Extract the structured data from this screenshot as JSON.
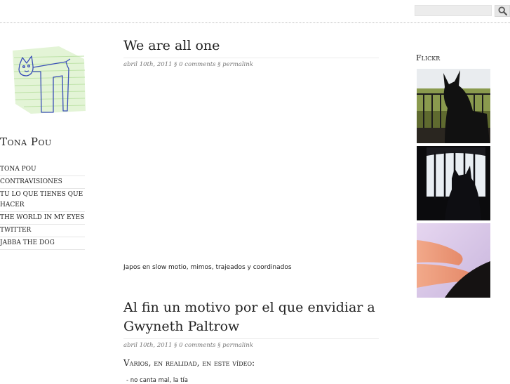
{
  "search": {
    "value": "",
    "placeholder": ""
  },
  "site": {
    "title": "Tona Pou"
  },
  "nav": {
    "items": [
      {
        "label": "Tona Pou"
      },
      {
        "label": "Contravisiones"
      },
      {
        "label": "Tu lo que tienes que hacer"
      },
      {
        "label": "The world in my eyes"
      },
      {
        "label": "Twitter"
      },
      {
        "label": "Jabba the dog"
      }
    ]
  },
  "posts": [
    {
      "title": "We are all one",
      "date": "abril 10th, 2011",
      "comments": "0 comments",
      "permalink": "permalink",
      "caption": "Japos en slow motio, mimos, trajeados y coordinados"
    },
    {
      "title_line1": "Al fin un motivo por el que envidiar a",
      "title_line2": "Gwyneth Paltrow",
      "date": "abril 10th, 2011",
      "comments": "0 comments",
      "permalink": "permalink",
      "intro": "Varios, en realidad, en este vídeo:",
      "first_item": "- no canta mal, la tía"
    }
  ],
  "flickr": {
    "heading": "Flickr"
  },
  "meta_separator": "§"
}
